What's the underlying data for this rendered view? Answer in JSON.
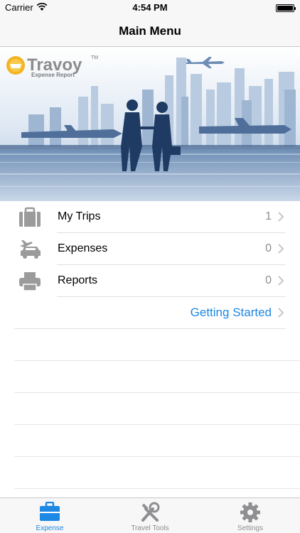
{
  "status_bar": {
    "carrier": "Carrier",
    "time": "4:54 PM"
  },
  "nav": {
    "title": "Main Menu"
  },
  "banner": {
    "logo_name": "Travoy",
    "logo_subtitle": "Expense Report",
    "logo_mark": "TM"
  },
  "menu": {
    "items": [
      {
        "label": "My Trips",
        "count": "1",
        "icon": "briefcase-icon"
      },
      {
        "label": "Expenses",
        "count": "0",
        "icon": "plane-car-icon"
      },
      {
        "label": "Reports",
        "count": "0",
        "icon": "printer-icon"
      }
    ],
    "getting_started": "Getting Started"
  },
  "tabs": [
    {
      "label": "Expense",
      "icon": "suitcase-icon",
      "active": true
    },
    {
      "label": "Travel Tools",
      "icon": "tools-icon",
      "active": false
    },
    {
      "label": "Settings",
      "icon": "gear-icon",
      "active": false
    }
  ],
  "colors": {
    "accent": "#1e88e5",
    "icon_gray": "#9b9b9b"
  }
}
